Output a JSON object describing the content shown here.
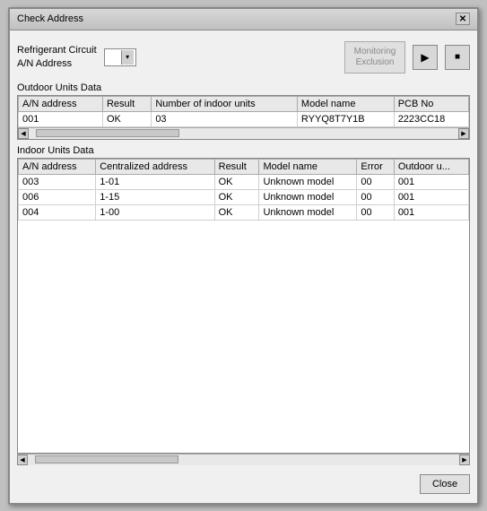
{
  "window": {
    "title": "Check Address",
    "close_label": "✕"
  },
  "top_bar": {
    "refrigerant_label": "Refrigerant Circuit\nA/N Address",
    "dropdown_value": "",
    "monitoring_btn_label": "Monitoring\nExclusion",
    "play_btn_icon": "▶",
    "stop_btn_icon": "■"
  },
  "outdoor_section": {
    "label": "Outdoor Units Data",
    "columns": [
      "A/N address",
      "Result",
      "Number of indoor units",
      "Model name",
      "PCB No"
    ],
    "rows": [
      [
        "001",
        "OK",
        "03",
        "RYYQ8T7Y1B",
        "2223CC18"
      ]
    ]
  },
  "indoor_section": {
    "label": "Indoor Units Data",
    "columns": [
      "A/N address",
      "Centralized address",
      "Result",
      "Model name",
      "Error",
      "Outdoor u..."
    ],
    "rows": [
      [
        "003",
        "1-01",
        "OK",
        "Unknown model",
        "00",
        "001"
      ],
      [
        "006",
        "1-15",
        "OK",
        "Unknown model",
        "00",
        "001"
      ],
      [
        "004",
        "1-00",
        "OK",
        "Unknown model",
        "00",
        "001"
      ]
    ]
  },
  "bottom": {
    "close_label": "Close"
  }
}
